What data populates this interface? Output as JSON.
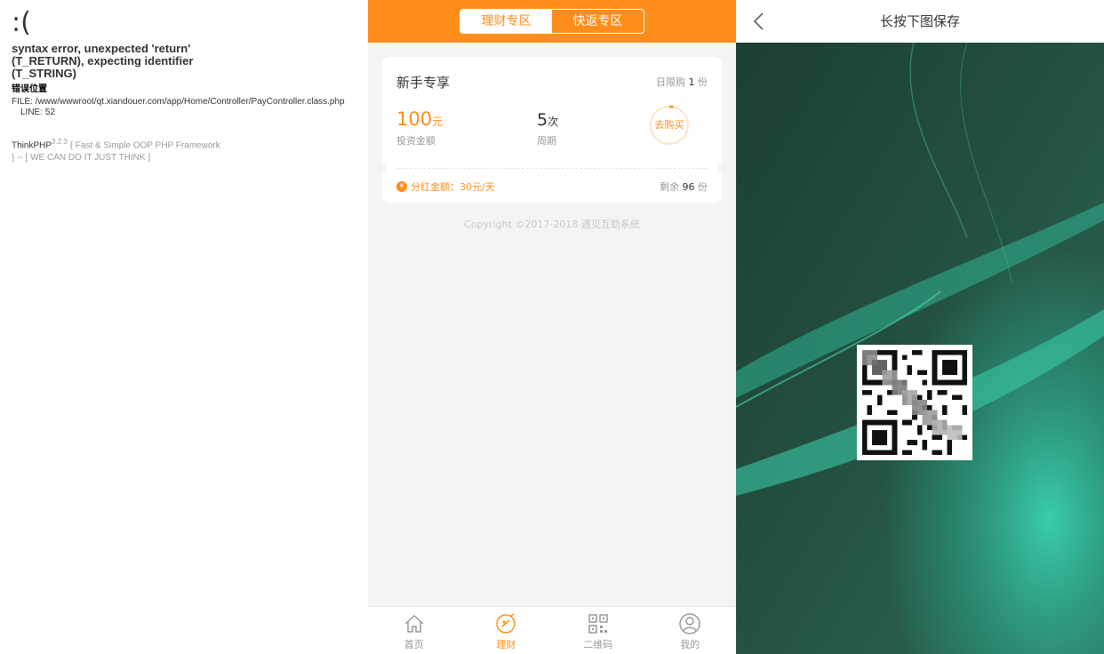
{
  "error_page": {
    "face": ":(",
    "message": "syntax error, unexpected 'return' (T_RETURN), expecting identifier (T_STRING)",
    "location_title": "错误位置",
    "file": "FILE: /www/wwwroot/qt.xiandouer.com/app/Home/Controller/PayController.class.php",
    "line": "LINE: 52",
    "framework": "ThinkPHP",
    "version": "3.2.3",
    "slogan": "{ Fast & Simple OOP PHP Framework } -- [ WE CAN DO IT JUST THINK ]"
  },
  "mid": {
    "tabs": [
      "理财专区",
      "快返专区"
    ],
    "active_tab": 0,
    "card": {
      "title": "新手专享",
      "daily_limit_label": "日限购",
      "daily_limit_value": "1",
      "daily_limit_unit": "份",
      "amount_value": "100",
      "amount_unit": "元",
      "amount_label": "投资金额",
      "period_value": "5",
      "period_unit": "次",
      "period_label": "周期",
      "buy_label": "去购买",
      "dividend_icon": "¥",
      "dividend": "分红金额：30元/天",
      "remain_label": "剩余",
      "remain_value": "96",
      "remain_unit": "份"
    },
    "copyright": "Copyright ©2017-2018 遇见互助系统",
    "tabbar": [
      {
        "label": "首页",
        "icon": "home-icon"
      },
      {
        "label": "理财",
        "icon": "finance-icon"
      },
      {
        "label": "二维码",
        "icon": "qrcode-icon"
      },
      {
        "label": "我的",
        "icon": "user-icon"
      }
    ],
    "active_tabbar": 1
  },
  "right": {
    "title": "长按下图保存"
  },
  "colors": {
    "accent": "#ff8d1a",
    "poster_dark": "#1f4a3a",
    "poster_teal": "#3ad3b0"
  }
}
